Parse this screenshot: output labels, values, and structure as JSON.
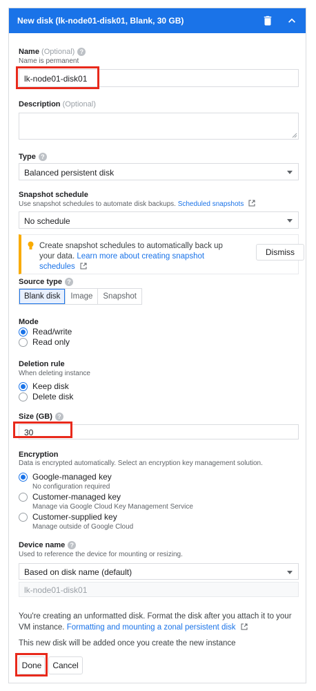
{
  "header": {
    "title": "New disk (lk-node01-disk01, Blank, 30 GB)"
  },
  "name": {
    "label": "Name",
    "optional": "(Optional)",
    "sub": "Name is permanent",
    "value": "lk-node01-disk01"
  },
  "description": {
    "label": "Description",
    "optional": "(Optional)",
    "value": ""
  },
  "type": {
    "label": "Type",
    "value": "Balanced persistent disk"
  },
  "snapshot": {
    "label": "Snapshot schedule",
    "sub": "Use snapshot schedules to automate disk backups.",
    "link": "Scheduled snapshots",
    "value": "No schedule"
  },
  "notice": {
    "text": "Create snapshot schedules to automatically back up your data.",
    "link": "Learn more about creating snapshot schedules",
    "dismiss": "Dismiss"
  },
  "source_type": {
    "label": "Source type",
    "options": [
      "Blank disk",
      "Image",
      "Snapshot"
    ],
    "selected": "Blank disk"
  },
  "mode": {
    "label": "Mode",
    "options": [
      "Read/write",
      "Read only"
    ],
    "selected": "Read/write"
  },
  "deletion": {
    "label": "Deletion rule",
    "sub": "When deleting instance",
    "options": [
      "Keep disk",
      "Delete disk"
    ],
    "selected": "Keep disk"
  },
  "size": {
    "label": "Size (GB)",
    "value": "30"
  },
  "encryption": {
    "label": "Encryption",
    "sub": "Data is encrypted automatically. Select an encryption key management solution.",
    "options": [
      {
        "label": "Google-managed key",
        "sub": "No configuration required"
      },
      {
        "label": "Customer-managed key",
        "sub": "Manage via Google Cloud Key Management Service"
      },
      {
        "label": "Customer-supplied key",
        "sub": "Manage outside of Google Cloud"
      }
    ],
    "selected": "Google-managed key"
  },
  "device": {
    "label": "Device name",
    "sub": "Used to reference the device for mounting or resizing.",
    "value": "Based on disk name (default)",
    "placeholder": "lk-node01-disk01"
  },
  "footer": {
    "unformatted_text": "You're creating an unformatted disk. Format the disk after you attach it to your VM instance.",
    "unformatted_link": "Formatting and mounting a zonal persistent disk",
    "added_text": "This new disk will be added once you create the new instance",
    "done": "Done",
    "cancel": "Cancel"
  },
  "colors": {
    "accent": "#1a73e8",
    "highlight": "#e8291b",
    "notice": "#f9ab00"
  }
}
